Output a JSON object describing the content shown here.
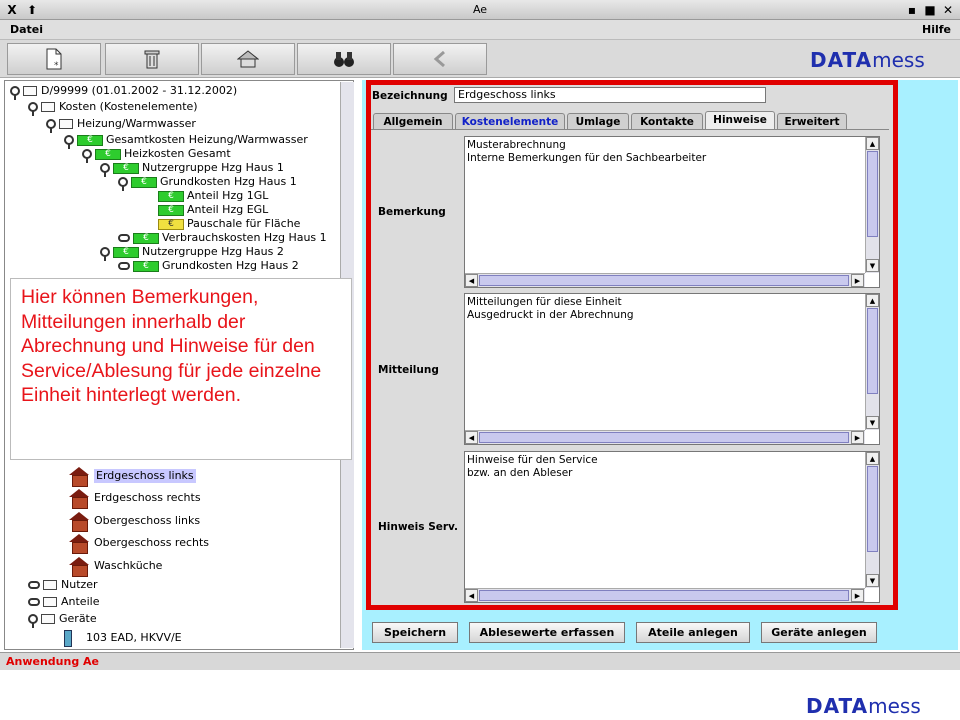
{
  "window": {
    "title": "Ae"
  },
  "menu": {
    "file": "Datei",
    "help": "Hilfe"
  },
  "toolbar": {
    "buttons": [
      "new-document-icon",
      "trash-icon",
      "home-icon",
      "binoculars-icon",
      "back-arrow-icon"
    ]
  },
  "logo": {
    "part1": "DATA",
    "part2": "mess"
  },
  "tree": {
    "root": "D/99999 (01.01.2002 - 31.12.2002)",
    "kosten": "Kosten (Kostenelemente)",
    "heizung": "Heizung/Warmwasser",
    "gesamtkosten": "Gesamtkosten Heizung/Warmwasser",
    "heizkosten": "Heizkosten Gesamt",
    "ng1": "Nutzergruppe Hzg Haus 1",
    "gk1": "Grundkosten Hzg Haus 1",
    "anteil1gl": "Anteil Hzg 1GL",
    "anteilegl": "Anteil Hzg EGL",
    "pauschale": "Pauschale für Fläche",
    "verbrauch1": "Verbrauchskosten Hzg Haus 1",
    "ng2": "Nutzergruppe Hzg Haus 2",
    "gk2": "Grundkosten Hzg Haus 2",
    "units": [
      "Erdgeschoss links",
      "Erdgeschoss rechts",
      "Obergeschoss links",
      "Obergeschoss rechts",
      "Waschküche"
    ],
    "nutzer": "Nutzer",
    "anteile": "Anteile",
    "geraete": "Geräte",
    "device": "103 EAD, HKVV/E"
  },
  "callout": "Hier können Bemerkungen, Mitteilungen innerhalb der Abrechnung und Hinweise für den Service/Ablesung für jede einzelne Einheit hinterlegt werden.",
  "form": {
    "bezeichnung_label": "Bezeichnung",
    "bezeichnung_value": "Erdgeschoss links",
    "tabs": [
      "Allgemein",
      "Kostenelemente",
      "Umlage",
      "Kontakte",
      "Hinweise",
      "Erweitert"
    ],
    "active_tab": "Hinweise",
    "bemerkung_label": "Bemerkung",
    "bemerkung_text": "Musterabrechnung\nInterne Bemerkungen für den Sachbearbeiter",
    "mitteilung_label": "Mitteilung",
    "mitteilung_text": "Mitteilungen für diese Einheit\nAusgedruckt in der Abrechnung",
    "hinweis_label": "Hinweis Serv.",
    "hinweis_text": "Hinweise für den Service\nbzw. an den Ableser"
  },
  "buttons": {
    "save": "Speichern",
    "readings": "Ablesewerte erfassen",
    "shares": "Ateile anlegen",
    "devices": "Geräte anlegen"
  },
  "status": "Anwendung Ae",
  "colors": {
    "accent": "#1f2fae",
    "alert_red": "#e00000",
    "panel_bg": "#a8f0ff"
  }
}
